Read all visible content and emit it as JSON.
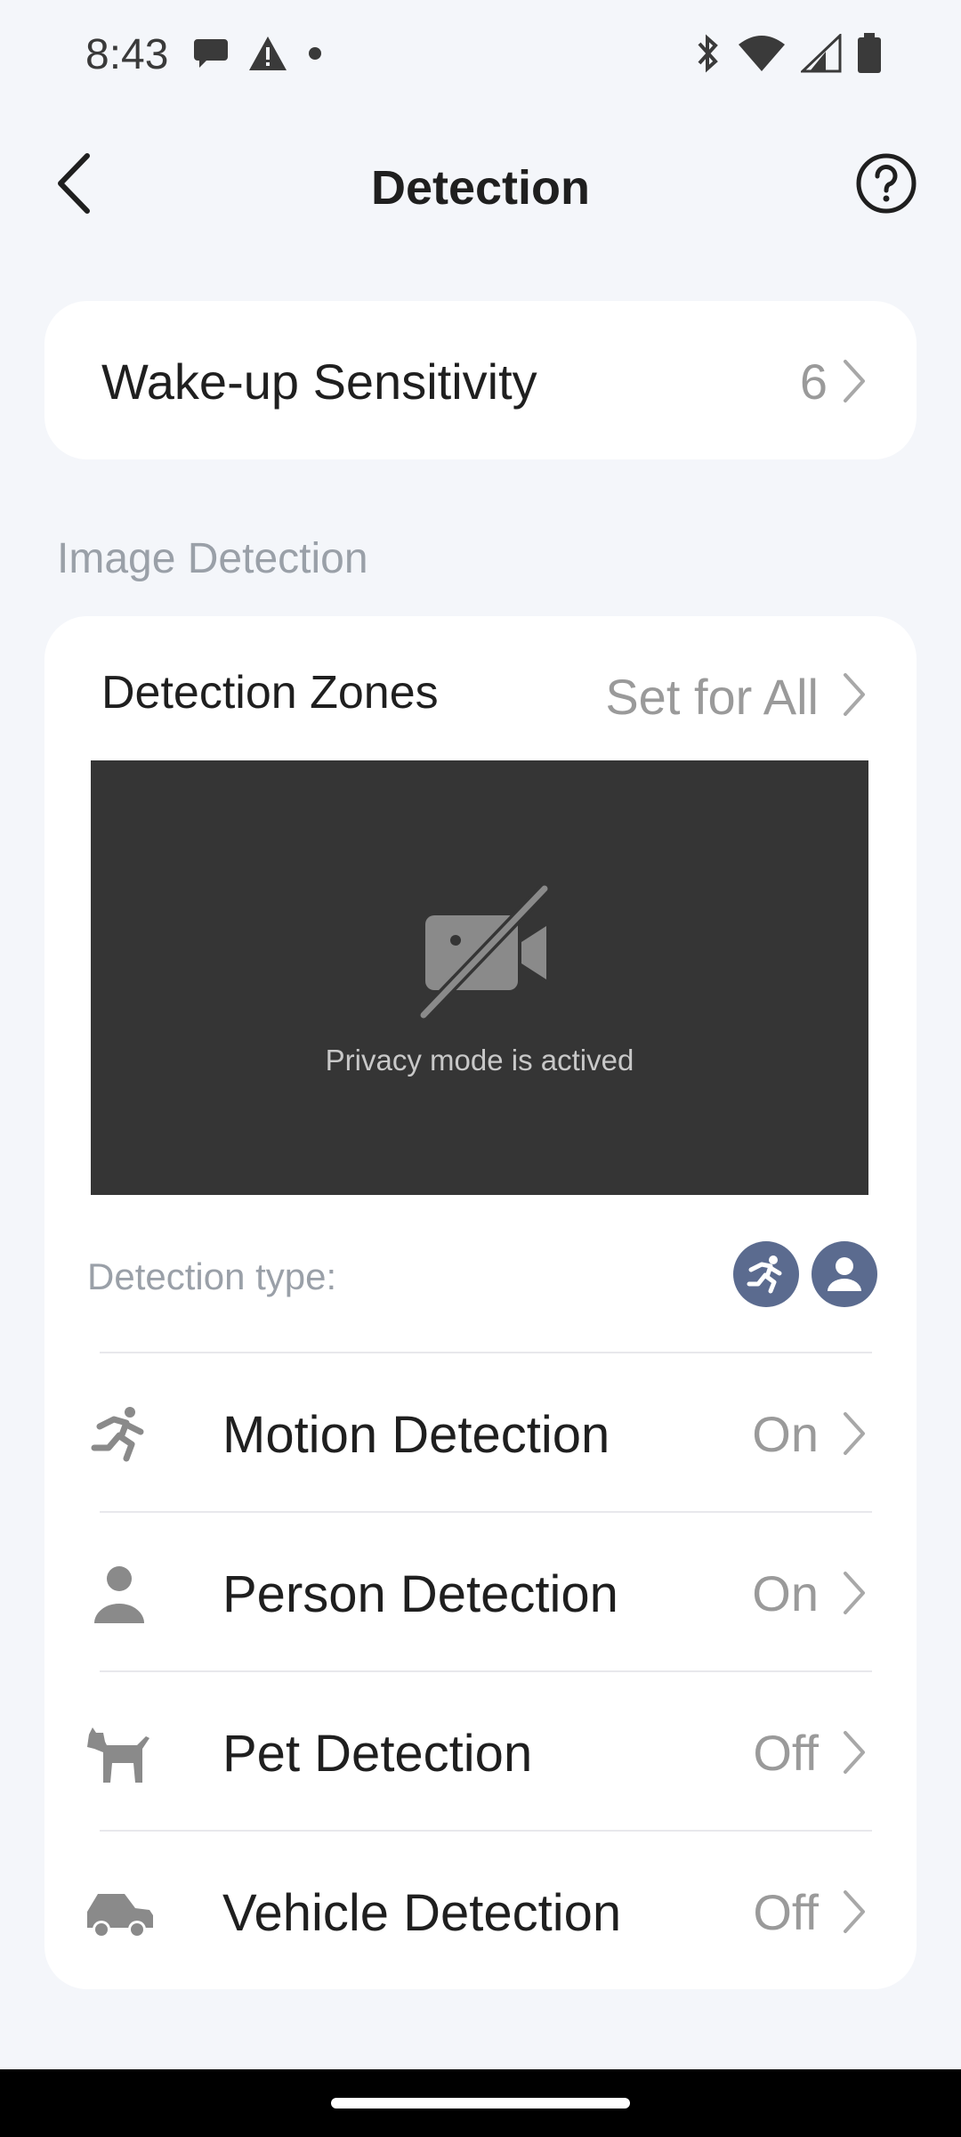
{
  "status_bar": {
    "time": "8:43",
    "left_icons": [
      "chat-bubble-icon",
      "warning-icon",
      "dot-icon"
    ],
    "right_icons": [
      "bluetooth-icon",
      "wifi-icon",
      "cell-signal-icon",
      "battery-icon"
    ]
  },
  "header": {
    "title": "Detection",
    "back_icon": "chevron-left-icon",
    "help_icon": "help-circle-icon"
  },
  "wake_up": {
    "label": "Wake-up Sensitivity",
    "value": "6"
  },
  "image_detection": {
    "section_title": "Image Detection",
    "zones_label": "Detection Zones",
    "zones_value": "Set for All",
    "privacy_text": "Privacy mode is actived",
    "detection_type_label": "Detection type:",
    "active_type_icons": [
      "motion-icon",
      "person-icon"
    ],
    "items": [
      {
        "label": "Motion Detection",
        "value": "On",
        "icon": "motion-icon"
      },
      {
        "label": "Person Detection",
        "value": "On",
        "icon": "person-icon"
      },
      {
        "label": "Pet Detection",
        "value": "Off",
        "icon": "pet-icon"
      },
      {
        "label": "Vehicle Detection",
        "value": "Off",
        "icon": "vehicle-icon"
      }
    ]
  },
  "colors": {
    "background": "#f4f6fa",
    "card": "#ffffff",
    "preview": "#353535",
    "badge": "#5b6b8f",
    "muted_text": "#9a9a9a"
  }
}
